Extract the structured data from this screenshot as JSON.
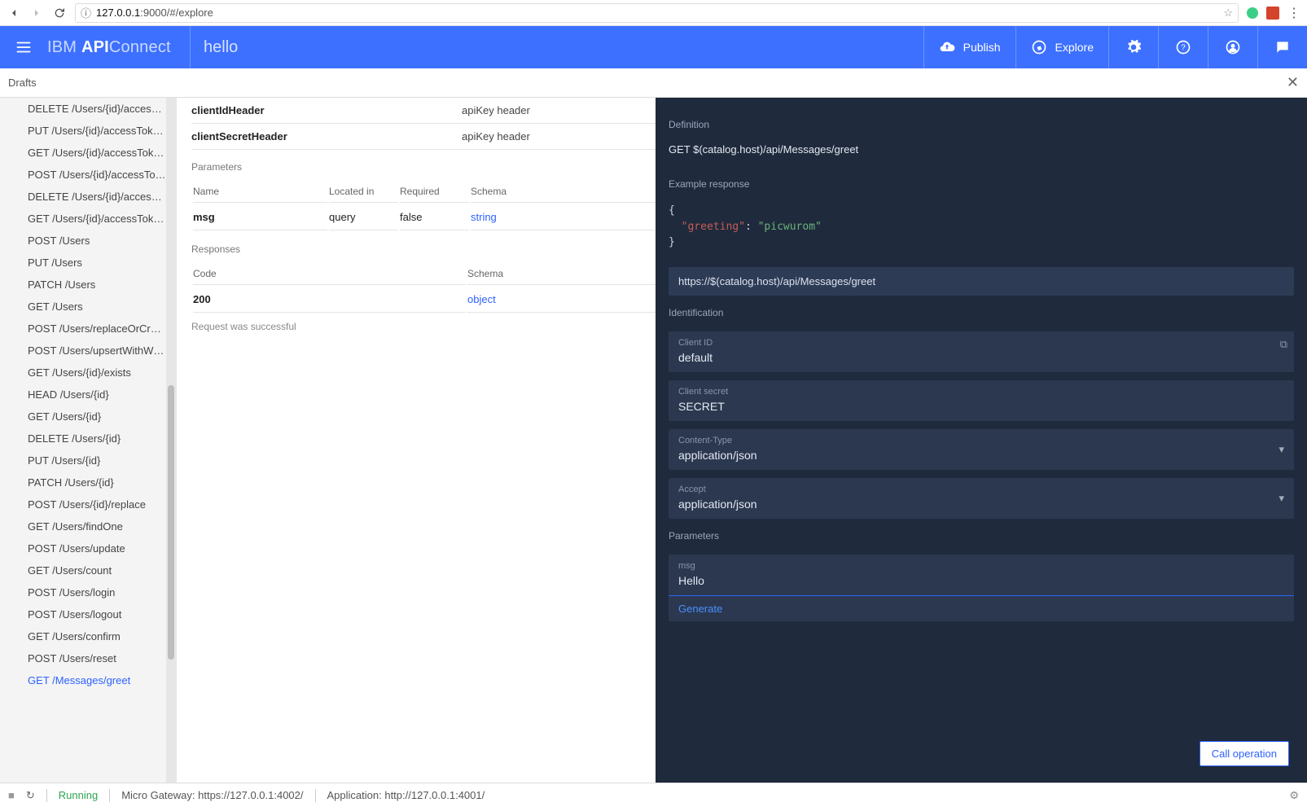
{
  "browser": {
    "url_prefix": "127.0.0.1",
    "url_rest": ":9000/#/explore"
  },
  "header": {
    "brand_ibm": "IBM",
    "brand_api": "API",
    "brand_connect": " Connect",
    "title": "hello",
    "publish_label": "Publish",
    "explore_label": "Explore"
  },
  "tabs": {
    "drafts": "Drafts"
  },
  "sidebar": {
    "items": [
      "DELETE /Users/{id}/accessT...",
      "PUT /Users/{id}/accessToken...",
      "GET /Users/{id}/accessTokens",
      "POST /Users/{id}/accessTok...",
      "DELETE /Users/{id}/accessT...",
      "GET /Users/{id}/accessToken...",
      "POST /Users",
      "PUT /Users",
      "PATCH /Users",
      "GET /Users",
      "POST /Users/replaceOrCreate",
      "POST /Users/upsertWithWhe...",
      "GET /Users/{id}/exists",
      "HEAD /Users/{id}",
      "GET /Users/{id}",
      "DELETE /Users/{id}",
      "PUT /Users/{id}",
      "PATCH /Users/{id}",
      "POST /Users/{id}/replace",
      "GET /Users/findOne",
      "POST /Users/update",
      "GET /Users/count",
      "POST /Users/login",
      "POST /Users/logout",
      "GET /Users/confirm",
      "POST /Users/reset",
      "GET /Messages/greet"
    ],
    "selected_index": 26
  },
  "doc": {
    "sec": {
      "clientId_name": "clientIdHeader",
      "clientId_desc": "apiKey header",
      "clientSecret_name": "clientSecretHeader",
      "clientSecret_desc": "apiKey header"
    },
    "params_label": "Parameters",
    "params_headers": {
      "name": "Name",
      "located": "Located in",
      "required": "Required",
      "schema": "Schema"
    },
    "params_row": {
      "name": "msg",
      "located": "query",
      "required": "false",
      "schema": "string"
    },
    "responses_label": "Responses",
    "responses_headers": {
      "code": "Code",
      "schema": "Schema"
    },
    "responses_row": {
      "code": "200",
      "schema": "object"
    },
    "req_success": "Request was successful"
  },
  "right": {
    "definition_label": "Definition",
    "definition_text": "GET $(catalog.host)/api/Messages/greet",
    "example_label": "Example response",
    "example_json_key": "\"greeting\"",
    "example_json_val": "\"picwurom\"",
    "url_display": "https://$(catalog.host)/api/Messages/greet",
    "identification_label": "Identification",
    "client_id_label": "Client ID",
    "client_id_value": "default",
    "client_secret_label": "Client secret",
    "client_secret_value": "SECRET",
    "content_type_label": "Content-Type",
    "content_type_value": "application/json",
    "accept_label": "Accept",
    "accept_value": "application/json",
    "parameters_label": "Parameters",
    "msg_label": "msg",
    "msg_value": "Hello",
    "generate_label": "Generate",
    "call_button": "Call operation"
  },
  "footer": {
    "running": "Running",
    "micro_label": "Micro Gateway: ",
    "micro_url": "https://127.0.0.1:4002/",
    "app_label": "Application: ",
    "app_url": "http://127.0.0.1:4001/"
  }
}
